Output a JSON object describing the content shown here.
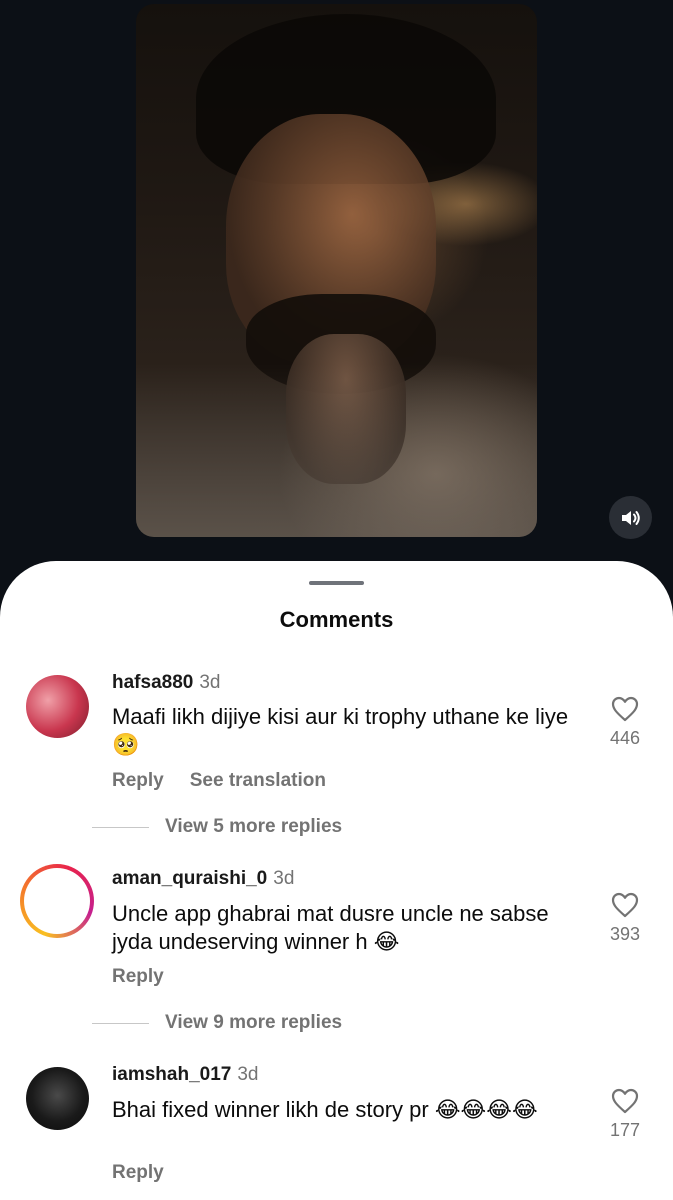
{
  "sheet": {
    "title": "Comments"
  },
  "comments": [
    {
      "username": "hafsa880",
      "time": "3d",
      "text": "Maafi likh dijiye kisi aur ki trophy uthane ke liye",
      "emoji": "🥺",
      "likes": "446",
      "reply_label": "Reply",
      "translate_label": "See translation",
      "view_replies": "View 5 more replies"
    },
    {
      "username": "aman_quraishi_0",
      "time": "3d",
      "text": "Uncle app ghabrai mat dusre uncle ne sabse jyda undeserving winner h",
      "emoji": "😂",
      "likes": "393",
      "reply_label": "Reply",
      "view_replies": "View 9 more replies"
    },
    {
      "username": "iamshah_017",
      "time": "3d",
      "text": "Bhai fixed winner likh de story pr",
      "emoji": "😂😂😂😂",
      "likes": "177",
      "reply_label": "Reply"
    }
  ],
  "icons": {
    "sound": "speaker-icon",
    "like": "heart-outline-icon"
  },
  "colors": {
    "background_dark": "#0b0f15",
    "sheet": "#ffffff",
    "muted_text": "#737373",
    "story_ring_start": "#f9c021",
    "story_ring_end": "#c5208f"
  }
}
